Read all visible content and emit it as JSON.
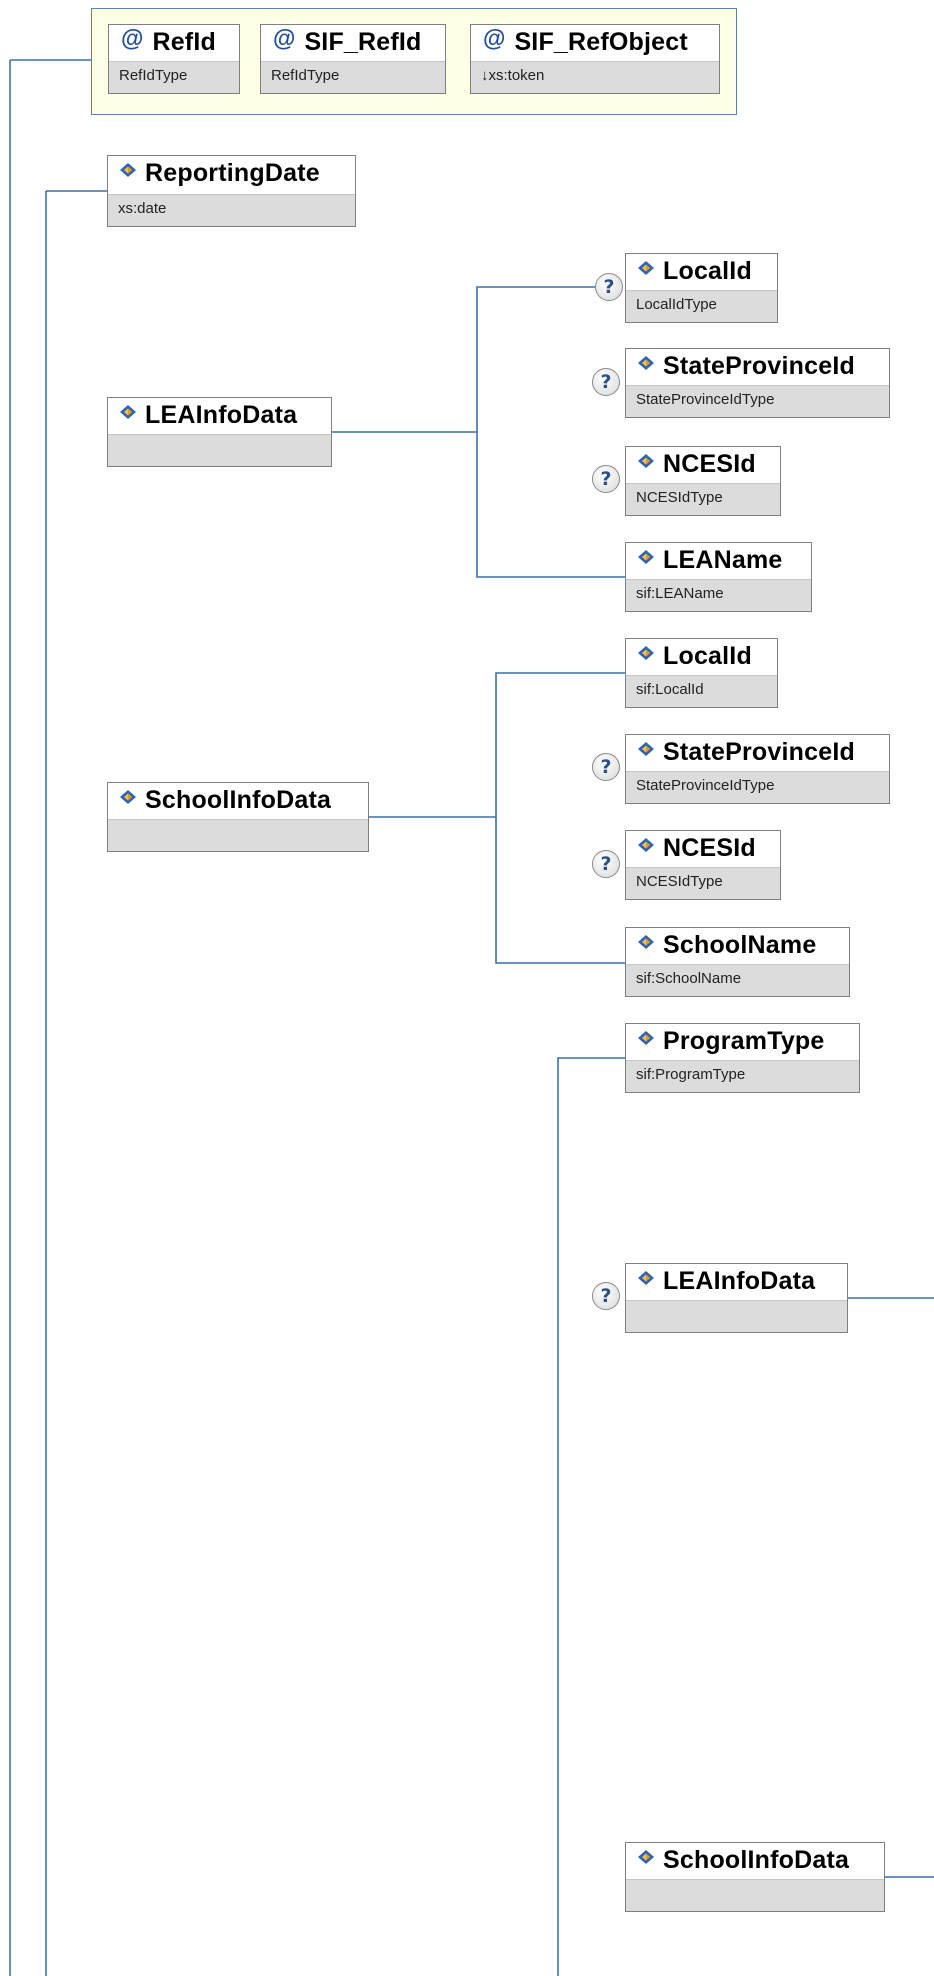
{
  "attributes": [
    {
      "name": "RefId",
      "type": "RefIdType"
    },
    {
      "name": "SIF_RefId",
      "type": "RefIdType"
    },
    {
      "name": "SIF_RefObject",
      "type": "↓xs:token"
    }
  ],
  "reporting_date": {
    "name": "ReportingDate",
    "type": "xs:date"
  },
  "lea_info": {
    "name": "LEAInfoData",
    "children": [
      {
        "name": "LocalId",
        "type": "LocalIdType",
        "optional": true
      },
      {
        "name": "StateProvinceId",
        "type": "StateProvinceIdType",
        "optional": true
      },
      {
        "name": "NCESId",
        "type": "NCESIdType",
        "optional": true
      },
      {
        "name": "LEAName",
        "type": "sif:LEAName",
        "optional": false
      }
    ]
  },
  "school_info": {
    "name": "SchoolInfoData",
    "children": [
      {
        "name": "LocalId",
        "type": "sif:LocalId",
        "optional": false
      },
      {
        "name": "StateProvinceId",
        "type": "StateProvinceIdType",
        "optional": true
      },
      {
        "name": "NCESId",
        "type": "NCESIdType",
        "optional": true
      },
      {
        "name": "SchoolName",
        "type": "sif:SchoolName",
        "optional": false
      }
    ]
  },
  "program": {
    "program_type": {
      "name": "ProgramType",
      "type": "sif:ProgramType"
    },
    "lea_info_data": {
      "name": "LEAInfoData",
      "optional": true
    },
    "school_info_data": {
      "name": "SchoolInfoData",
      "optional": false
    }
  },
  "optional_marker": "?",
  "icons": {
    "attribute": "@",
    "element": "element-diamond-icon",
    "optional": "question-icon"
  },
  "colors": {
    "connector": "#3d6fa8",
    "attribute_box": "#ffffe6",
    "type_bar": "#dcdcdc"
  }
}
